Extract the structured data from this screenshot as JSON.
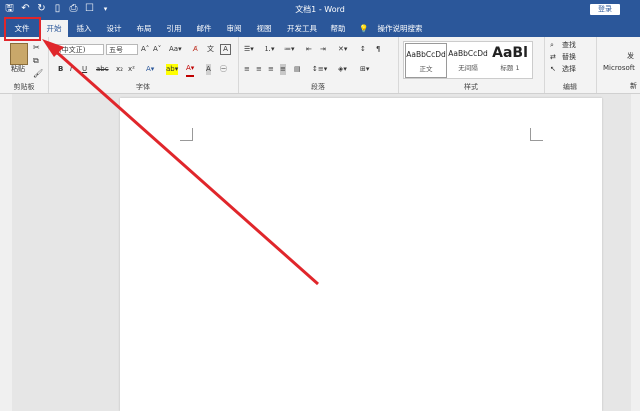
{
  "window": {
    "title": "文档1 - Word",
    "login_label": "登录"
  },
  "qat": {
    "icons": [
      "save-icon",
      "undo-icon",
      "redo-icon",
      "new-doc-icon",
      "print-preview-icon",
      "touch-mode-icon",
      "customize-icon"
    ]
  },
  "tabs": [
    "文件",
    "开始",
    "插入",
    "设计",
    "布局",
    "引用",
    "邮件",
    "审阅",
    "视图",
    "开发工具",
    "帮助",
    "操作说明搜索"
  ],
  "active_tab": "开始",
  "ribbon": {
    "clipboard": {
      "paste_label": "粘贴",
      "group_label": "剪贴板"
    },
    "font": {
      "font_name": "(中文正)",
      "font_size": "五号",
      "bold": "B",
      "italic": "I",
      "underline": "U",
      "group_label": "字体"
    },
    "paragraph": {
      "group_label": "段落"
    },
    "styles": {
      "items": [
        {
          "preview": "AaBbCcDd",
          "name": "正文"
        },
        {
          "preview": "AaBbCcDd",
          "name": "无间隔"
        },
        {
          "preview": "AaBl",
          "name": "标题 1"
        }
      ],
      "group_label": "样式"
    },
    "editing": {
      "find": "查找",
      "replace": "替换",
      "select": "选择",
      "group_label": "编辑"
    },
    "more": {
      "label": "Microsoft",
      "cut_label": "发",
      "group_cut": "新"
    }
  },
  "colors": {
    "brand": "#2b579a",
    "highlight": "#e0262b",
    "arrow": "#e0262b"
  }
}
